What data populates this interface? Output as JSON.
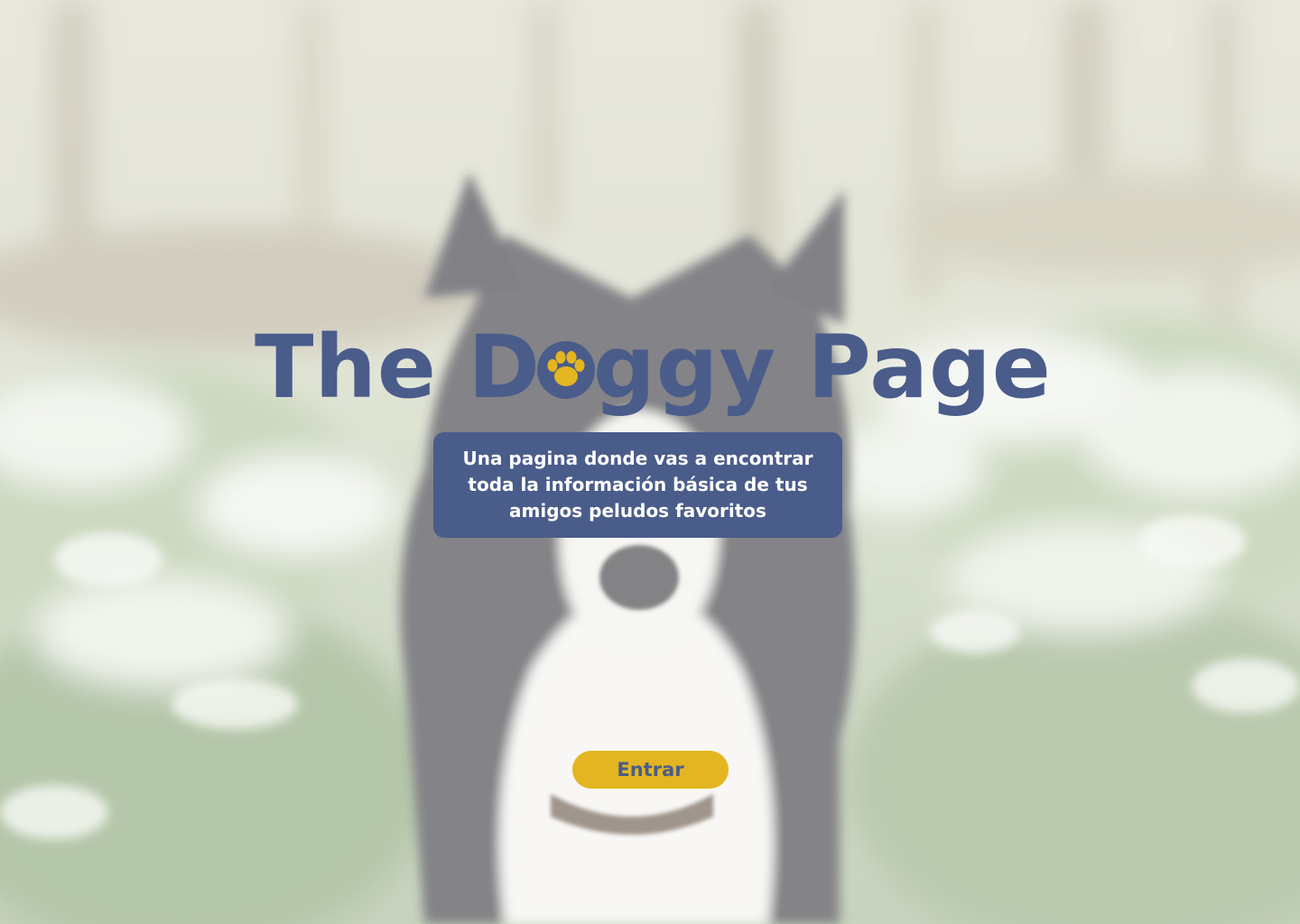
{
  "theme": {
    "brand_color": "#4a5c8a",
    "accent_color": "#e3b520"
  },
  "hero": {
    "title_before": "The D",
    "title_after": "ggy Page",
    "title_icon": "paw-print-icon",
    "subtitle": "Una pagina donde vas a encontrar toda la información básica de tus amigos peludos favoritos",
    "enter_label": "Entrar"
  },
  "background": {
    "image": "border-collie-dog-photo"
  }
}
